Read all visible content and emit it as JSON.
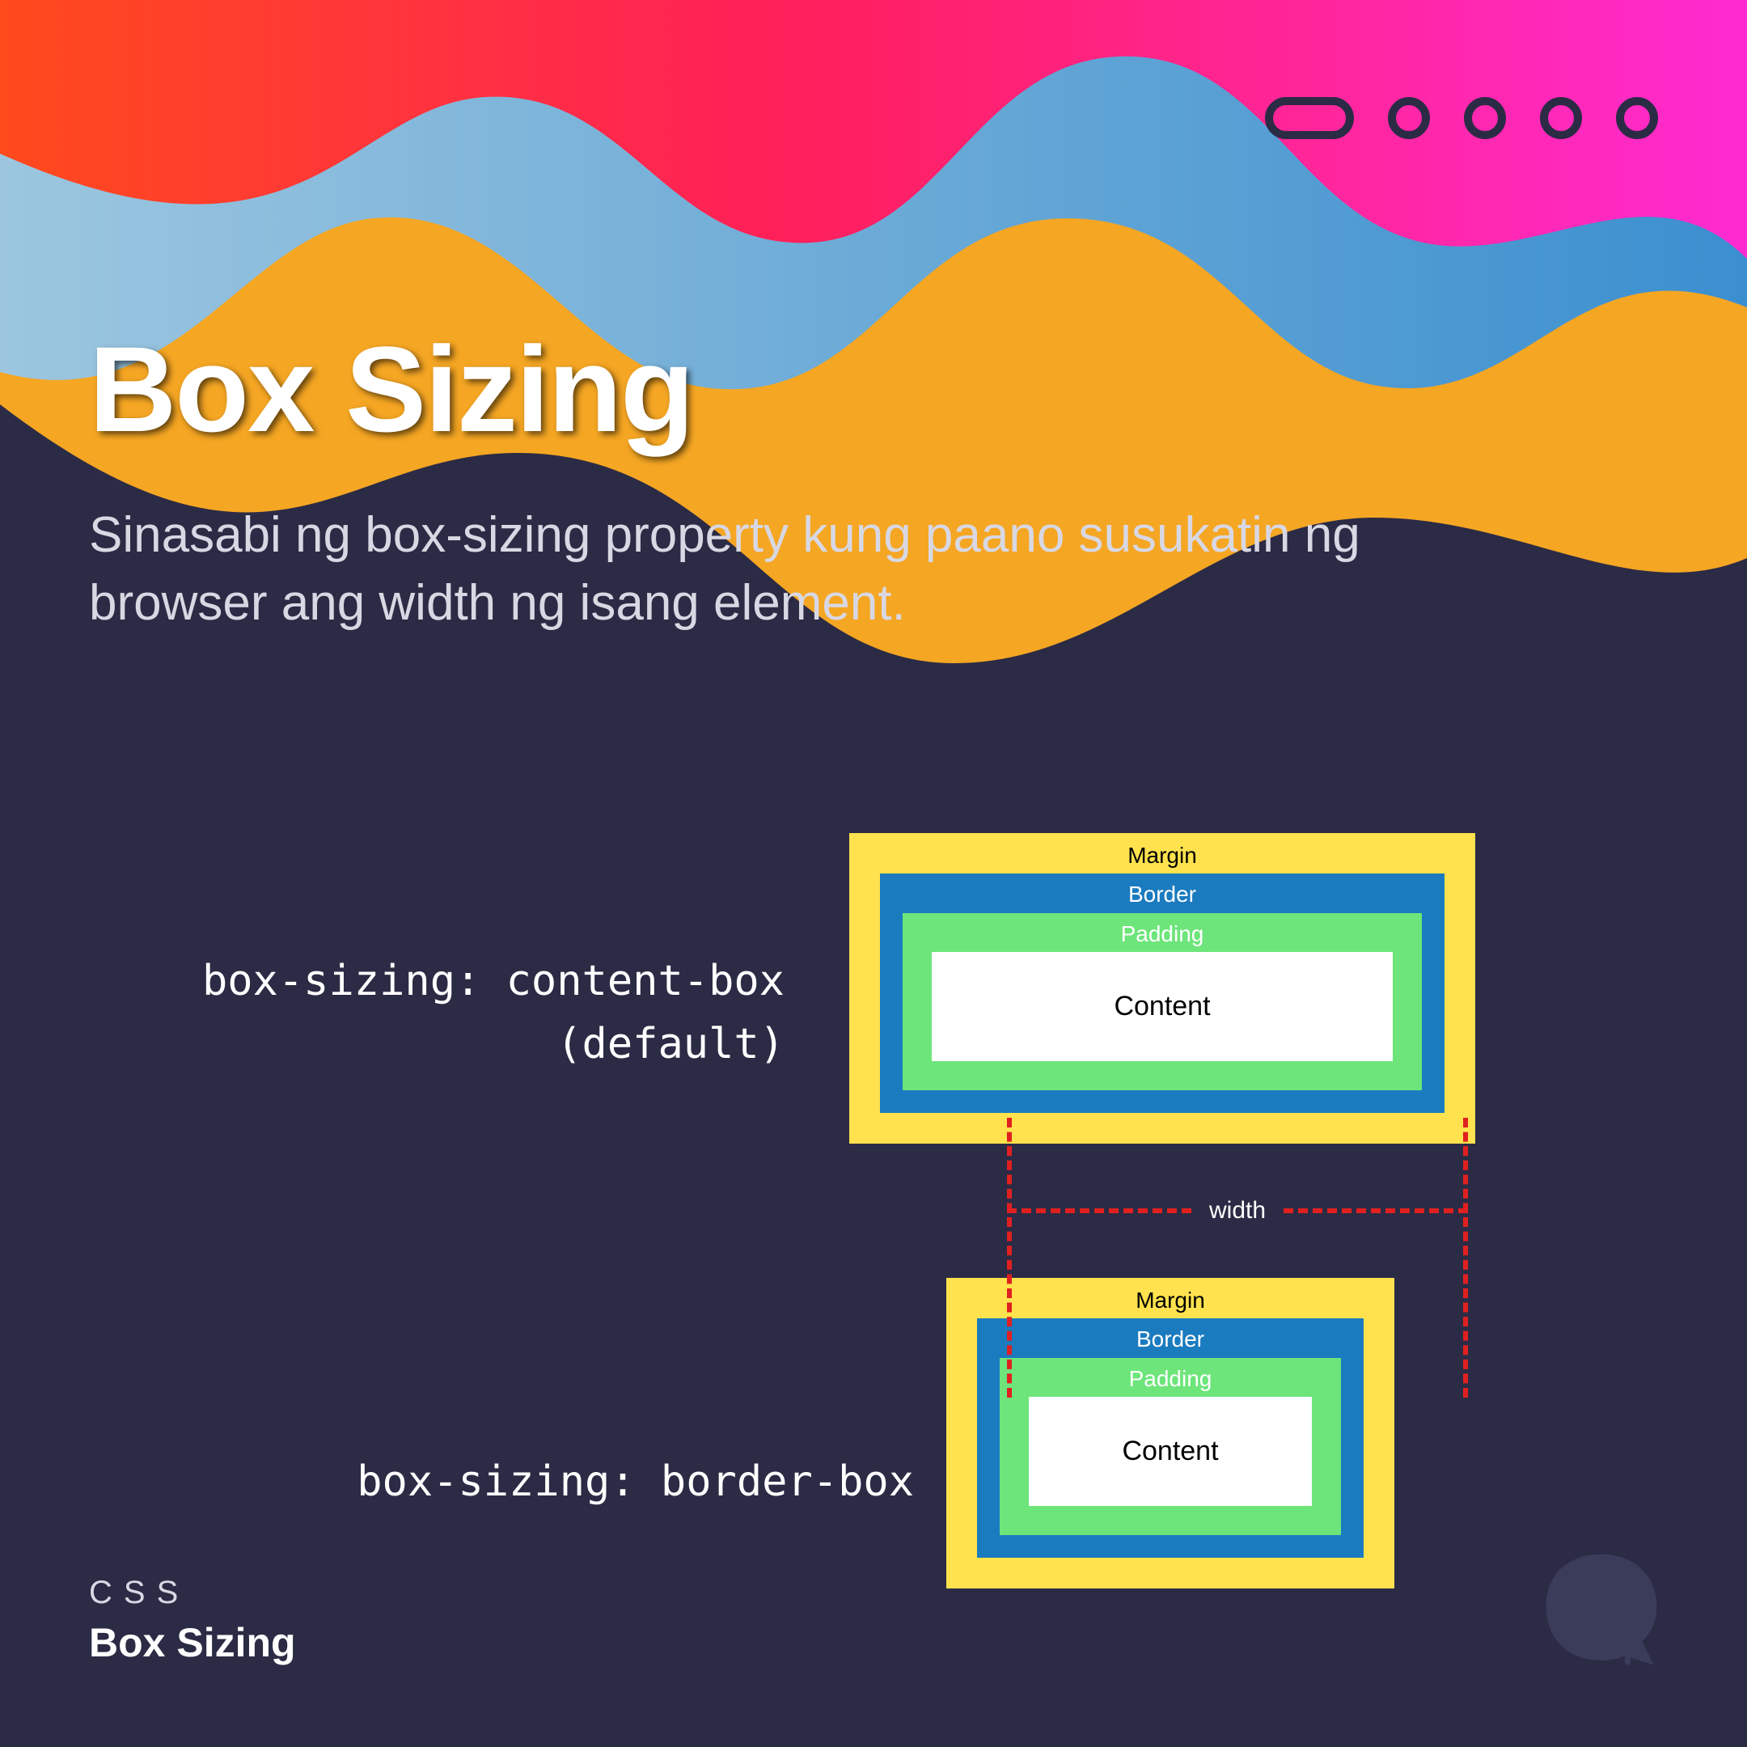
{
  "header": {
    "title": "Box Sizing",
    "subtitle": "Sinasabi ng box-sizing property kung paano susukatin ng browser ang width ng isang element."
  },
  "examples": {
    "content_box": {
      "code_line1": "box-sizing: content-box",
      "code_line2": "(default)"
    },
    "border_box": {
      "code_line1": "box-sizing: border-box"
    }
  },
  "box_model_labels": {
    "margin": "Margin",
    "border": "Border",
    "padding": "Padding",
    "content": "Content"
  },
  "annotations": {
    "width_label": "width"
  },
  "footer": {
    "eyebrow": "CSS",
    "title": "Box Sizing"
  },
  "pager": {
    "current": 1,
    "total": 5
  },
  "colors": {
    "bg": "#2b2b45",
    "margin": "#ffe24d",
    "border": "#1b7bbf",
    "padding": "#6de57a",
    "content": "#ffffff",
    "dash": "#e02020"
  }
}
